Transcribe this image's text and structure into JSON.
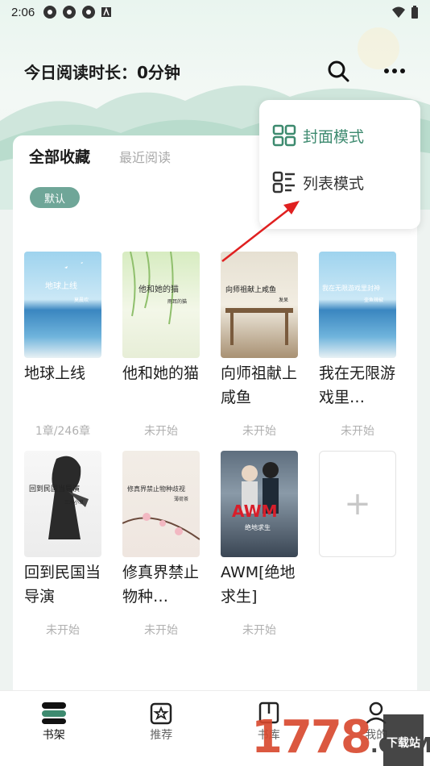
{
  "status_bar": {
    "time": "2:06"
  },
  "header": {
    "title": "今日阅读时长：0分钟"
  },
  "tabs": {
    "active": "全部收藏",
    "inactive": "最近阅读"
  },
  "tag_chip": "默认",
  "popup_menu": {
    "items": [
      {
        "label": "封面模式",
        "icon": "grid-icon",
        "color": "#3d8a6f"
      },
      {
        "label": "列表模式",
        "icon": "list-icon",
        "color": "#333333"
      }
    ]
  },
  "books": [
    {
      "title": "地球上线",
      "cover_title": "地球上线",
      "cover_author": "莫晨欢",
      "progress": "1章/246章",
      "cover_theme": "sea"
    },
    {
      "title": "他和她的猫",
      "cover_title": "他和她的猫",
      "cover_author": "雨耳的猫",
      "progress": "未开始",
      "cover_theme": "willow"
    },
    {
      "title": "向师祖献上咸鱼",
      "cover_title": "向师祖献上咸鱼",
      "cover_author": "发呆",
      "progress": "未开始",
      "cover_theme": "pavilion"
    },
    {
      "title": "我在无限游戏里…",
      "cover_title": "我在无限游戏里封神",
      "cover_author": "壶鱼辣椒",
      "progress": "未开始",
      "cover_theme": "sea"
    },
    {
      "title": "回到民国当导演",
      "cover_title": "回到民国当导演",
      "cover_author": "三水小草",
      "progress": "未开始",
      "cover_theme": "boy"
    },
    {
      "title": "修真界禁止物种…",
      "cover_title": "修真界禁止物种歧视",
      "cover_author": "薄荷茶",
      "progress": "未开始",
      "cover_theme": "blossom"
    },
    {
      "title": "AWM[绝地求生]",
      "cover_title": "AWM",
      "cover_author": "绝地求生",
      "progress": "未开始",
      "cover_theme": "awm"
    }
  ],
  "add_button": "+",
  "bottom_nav": [
    {
      "label": "书架",
      "icon": "bookshelf-icon",
      "active": true
    },
    {
      "label": "推荐",
      "icon": "recommend-icon",
      "active": false
    },
    {
      "label": "书库",
      "icon": "library-icon",
      "active": false
    },
    {
      "label": "我的",
      "icon": "profile-icon",
      "active": false
    }
  ],
  "watermark": {
    "main": "1778",
    "badge": "下载站",
    "domain": ".COM"
  },
  "colors": {
    "accent": "#3d8a6f",
    "chip": "#6fa698",
    "arrow": "#e02020"
  }
}
